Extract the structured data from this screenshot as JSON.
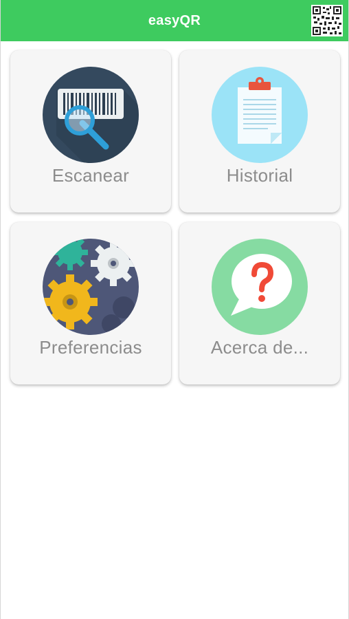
{
  "app_bar": {
    "title": "easyQR",
    "qr_icon": "qr-code-icon",
    "color": "#3ecb5f"
  },
  "menu": {
    "items": [
      {
        "label": "Escanear",
        "icon": "barcode-search-icon"
      },
      {
        "label": "Historial",
        "icon": "clipboard-icon"
      },
      {
        "label": "Preferencias",
        "icon": "gears-icon"
      },
      {
        "label": "Acerca de...",
        "icon": "question-bubble-icon"
      }
    ]
  }
}
